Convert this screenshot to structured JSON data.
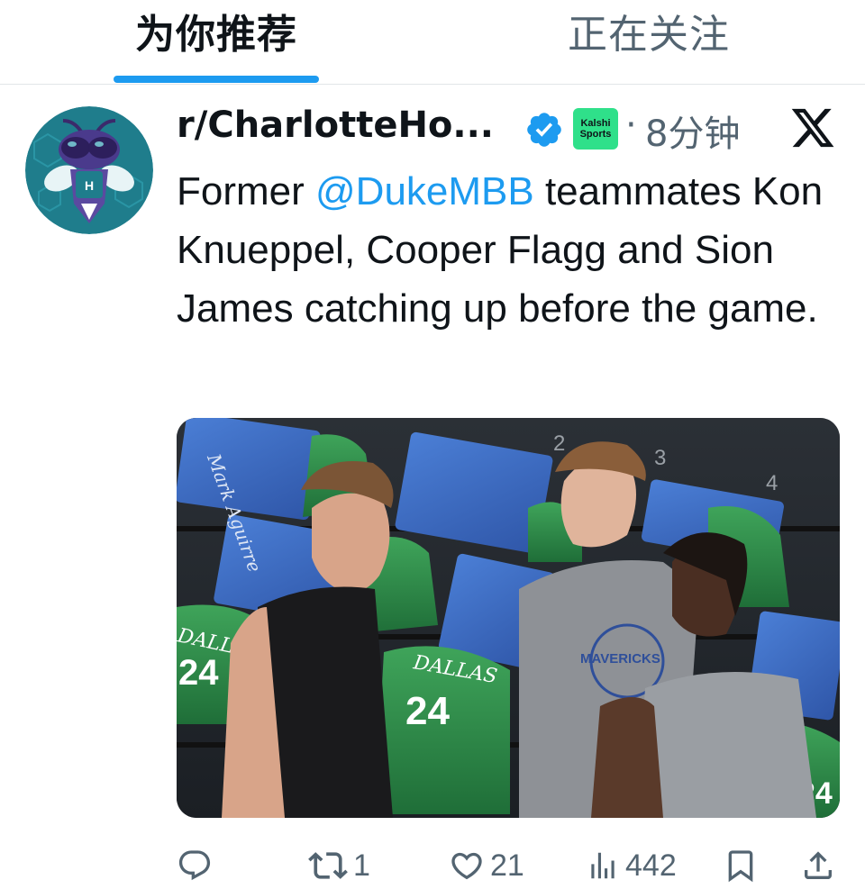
{
  "tabs": [
    {
      "label": "为你推荐",
      "active": true
    },
    {
      "label": "正在关注",
      "active": false
    }
  ],
  "tweet": {
    "author_name": "r/CharlotteHo...",
    "verified": true,
    "affiliate_badge": {
      "line1": "Kalshi",
      "line2": "Sports"
    },
    "separator": "·",
    "timestamp": "8分钟",
    "text_before": "Former ",
    "mention": "@DukeMBB",
    "text_after": " teammates Kon Knueppel, Cooper Flagg and Sion James catching up before the game.",
    "media": {
      "jersey_numbers": [
        "24",
        "24",
        "24"
      ],
      "jersey_text": "DALLAS",
      "shirt_text": "MAVERICKS",
      "seat_numbers": [
        "2",
        "3",
        "4"
      ],
      "poster_text": "Mark Aguirre"
    },
    "actions": {
      "reply_count": "",
      "retweet_count": "1",
      "like_count": "21",
      "views_count": "442"
    }
  },
  "colors": {
    "accent": "#1d9bf0",
    "muted_text": "#536471",
    "avatar_bg": "#1f7d8c",
    "badge_green": "#2fe08a"
  },
  "icons": [
    "verified-badge-icon",
    "x-logo-icon",
    "reply-icon",
    "retweet-icon",
    "like-icon",
    "views-icon",
    "bookmark-icon",
    "share-icon"
  ]
}
